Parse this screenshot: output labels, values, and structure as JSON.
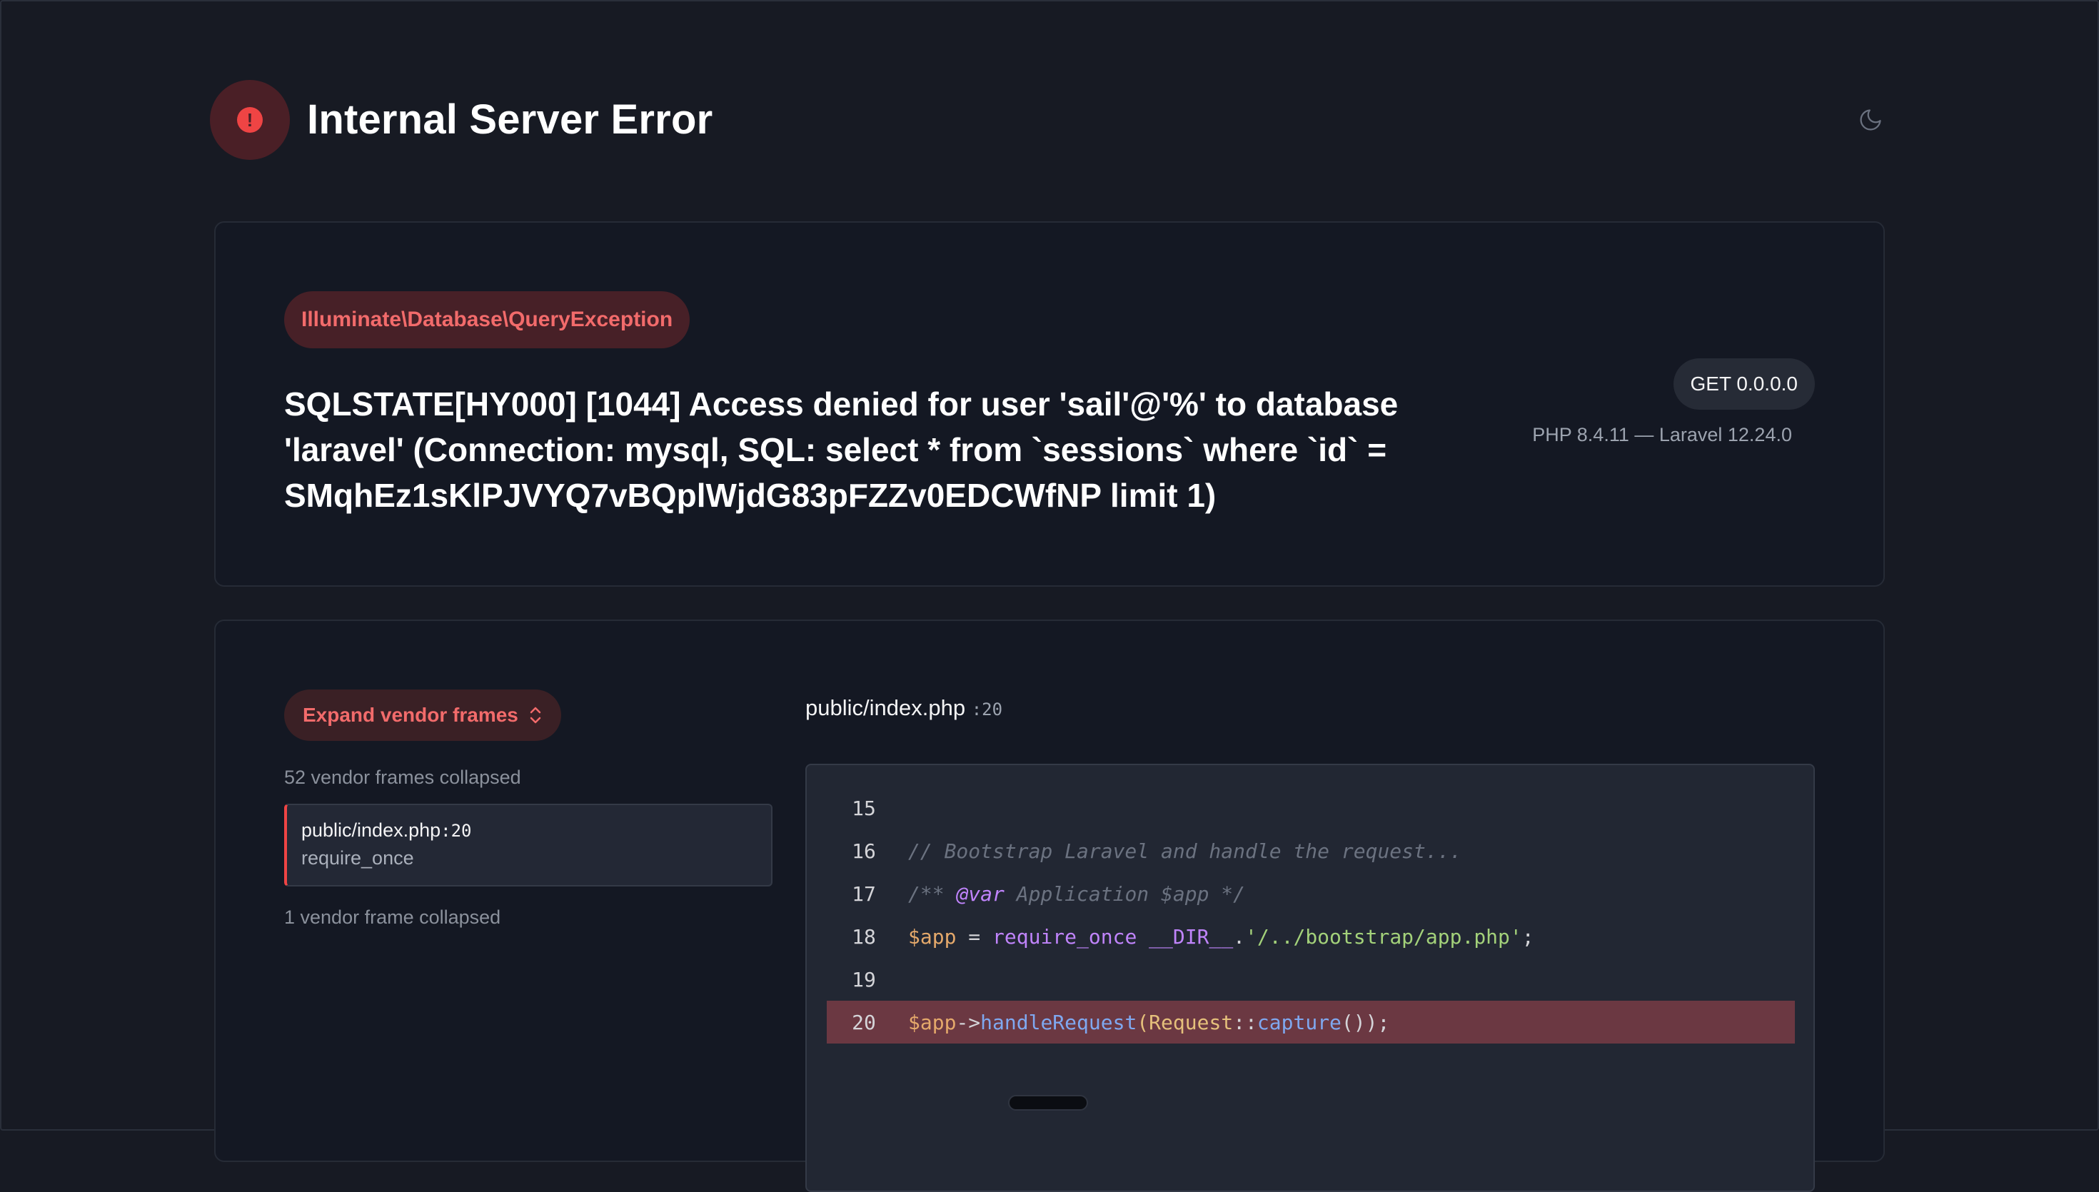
{
  "header": {
    "title": "Internal Server Error",
    "error_icon": "exclamation-circle-icon",
    "theme_icon": "moon-icon"
  },
  "exception": {
    "class": "Illuminate\\Database\\QueryException",
    "message": "SQLSTATE[HY000] [1044] Access denied for user 'sail'@'%' to database 'laravel' (Connection: mysql, SQL: select * from `sessions` where `id` = SMqhEz1sKlPJVYQ7vBQplWjdG83pFZZv0EDCWfNP limit 1)",
    "request": "GET 0.0.0.0",
    "versions": "PHP 8.4.11 — Laravel 12.24.0"
  },
  "frames": {
    "expand_label": "Expand vendor frames",
    "collapsed_before": "52 vendor frames collapsed",
    "active_frame": {
      "file": "public/index.php",
      "line": ":20",
      "function": "require_once"
    },
    "collapsed_after": "1 vendor frame collapsed"
  },
  "code": {
    "file": "public/index.php",
    "line": ":20",
    "lines": [
      {
        "num": "15"
      },
      {
        "num": "16",
        "text": "// Bootstrap Laravel and handle the request..."
      },
      {
        "num": "17",
        "tag": "@var",
        "text_a": "/** ",
        "text_b": " Application $app */"
      },
      {
        "num": "18",
        "var": "$app",
        "op": " = ",
        "kw": "require_once",
        "const": " __DIR__",
        "dot": ".",
        "str": "'/../bootstrap/app.php'",
        "end": ";"
      },
      {
        "num": "19"
      },
      {
        "num": "20",
        "var": "$app",
        "arrow": "->",
        "fn": "handleRequest",
        "p1": "(",
        "cls": "Request",
        "sep": "::",
        "fn2": "capture",
        "end": "());"
      }
    ],
    "highlight_line": "20"
  },
  "colors": {
    "background": "#171a23",
    "accent": "#f26b6b",
    "highlight": "#6b3842"
  }
}
